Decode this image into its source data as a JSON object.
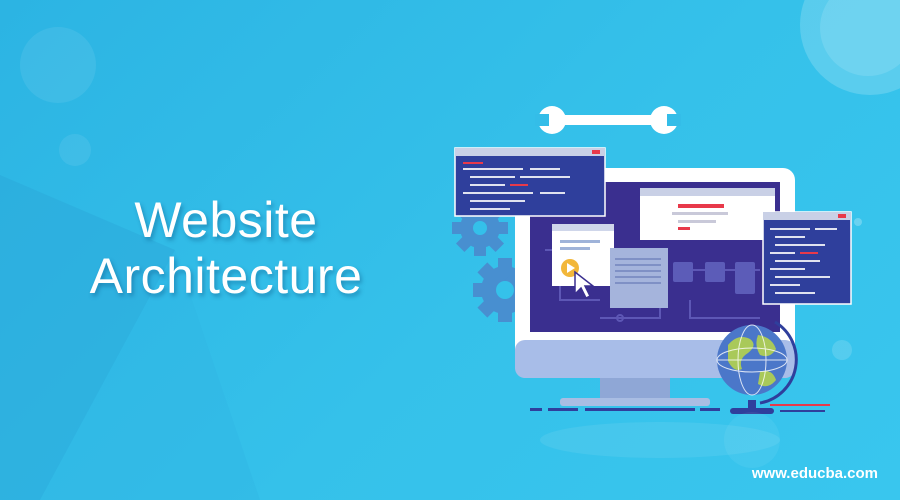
{
  "banner": {
    "title_line1": "Website",
    "title_line2": "Architecture",
    "site_url": "www.educba.com"
  },
  "colors": {
    "background": "#35c1ea",
    "monitor_frame": "#ffffff",
    "monitor_screen": "#3a2f8f",
    "code_window": "#2f3f9c",
    "accent_red": "#e8394a"
  },
  "icons": [
    "wrench-icon",
    "gear-icon",
    "cursor-icon",
    "globe-icon"
  ]
}
